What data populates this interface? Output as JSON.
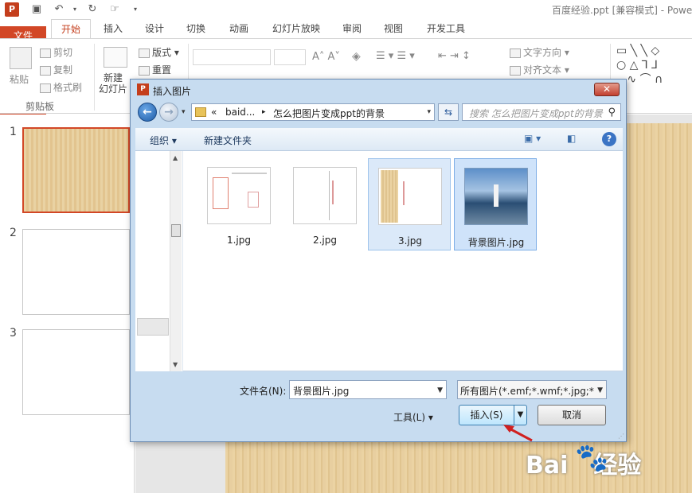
{
  "window": {
    "title": "百度经验.ppt [兼容模式] - Powe",
    "app_badge": "P",
    "quick_access": [
      "save-icon",
      "undo-icon",
      "redo-icon",
      "touch-mode-icon"
    ]
  },
  "ribbon": {
    "tabs": [
      {
        "label": "文件"
      },
      {
        "label": "开始"
      },
      {
        "label": "插入"
      },
      {
        "label": "设计"
      },
      {
        "label": "切换"
      },
      {
        "label": "动画"
      },
      {
        "label": "幻灯片放映"
      },
      {
        "label": "审阅"
      },
      {
        "label": "视图"
      },
      {
        "label": "开发工具"
      }
    ],
    "clipboard": {
      "paste": "粘贴",
      "cut": "剪切",
      "copy": "复制",
      "format_painter": "格式刷",
      "group": "剪贴板"
    },
    "slides": {
      "new_slide": "新建\n幻灯片",
      "layout": "版式",
      "reset": "重置"
    },
    "paragraph": {
      "text_direction": "文字方向",
      "align_text": "对齐文本"
    }
  },
  "thumbnails": {
    "slides": [
      {
        "number": "1"
      },
      {
        "number": "2"
      },
      {
        "number": "3"
      }
    ]
  },
  "dialog": {
    "title": "插入图片",
    "close": "✕",
    "address": {
      "prefix": "«",
      "crumb1": "baid...",
      "sep": "▸",
      "crumb2": "怎么把图片变成ppt的背景"
    },
    "search_placeholder": "搜索 怎么把图片变成ppt的背景",
    "commands": {
      "organize": "组织 ▾",
      "new_folder": "新建文件夹"
    },
    "files": [
      {
        "name": "1.jpg"
      },
      {
        "name": "2.jpg"
      },
      {
        "name": "3.jpg"
      },
      {
        "name": "背景图片.jpg"
      }
    ],
    "filename_label": "文件名(N):",
    "filename_value": "背景图片.jpg",
    "filter_value": "所有图片(*.emf;*.wmf;*.jpg;*.jp",
    "tools_label": "工具(L)  ▾",
    "insert_label": "插入(S)",
    "cancel_label": "取消"
  },
  "watermark": {
    "text_left": "Bai",
    "text_right": "经验"
  },
  "colors": {
    "accent": "#d24726",
    "dialog_chrome": "#c7dcf0",
    "selection": "#cfe3fa"
  }
}
